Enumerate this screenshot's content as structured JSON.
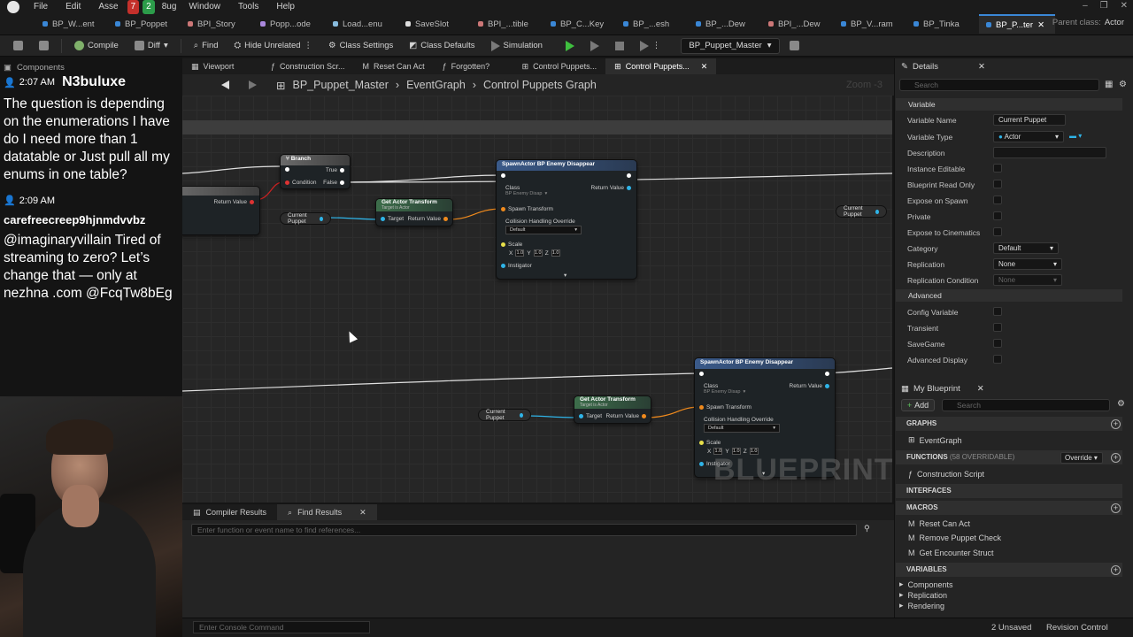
{
  "menu": [
    "File",
    "Edit",
    "Asse",
    "Window",
    "Tools",
    "Help"
  ],
  "notify": {
    "youtube": "7",
    "green": "2",
    "other": "8ug"
  },
  "doc_tabs": [
    "BP_W...ent",
    "BP_Poppet",
    "BPI_Story",
    "Popp...ode",
    "Load...enu",
    "SaveSlot",
    "BPI_...tible",
    "BP_C...Key",
    "BP_...esh",
    "BP_...Dew",
    "BPI_...Dew",
    "BP_V...ram",
    "BP_Tinka",
    "BP_P...ter"
  ],
  "parent_class": {
    "label": "Parent class:",
    "value": "Actor"
  },
  "toolbar": {
    "compile": "Compile",
    "diff": "Diff",
    "find": "Find",
    "hide_unrelated": "Hide Unrelated",
    "class_settings": "Class Settings",
    "class_defaults": "Class Defaults",
    "simulation": "Simulation",
    "debug_object": "BP_Puppet_Master"
  },
  "components_tab": "Components",
  "chat": {
    "time1": "2:07 AM",
    "user1": "N3buluxe",
    "msg1": "The question is depending on the enumerations I have do I need more than 1 datatable or Just pull all my enums in one table?",
    "time2": "2:09 AM",
    "user2": "carefreecreep9hjnmdvvbz",
    "msg2": "@imaginaryvillain Tired of streaming to zero? Let’s change that — only at nezhna .com @FcqTw8bEg"
  },
  "graph_tabs": [
    "Viewport",
    "Construction Scr...",
    "Reset Can Act",
    "Forgotten?",
    "Control Puppets...",
    "Control Puppets..."
  ],
  "breadcrumb": {
    "root": "BP_Puppet_Master",
    "sep": "›",
    "event": "EventGraph",
    "graph": "Control Puppets Graph"
  },
  "zoom": "Zoom -3",
  "watermark": "BLUEPRINT",
  "nodes": {
    "branch": {
      "title": "Branch",
      "true": "True",
      "false": "False",
      "condition": "Condition"
    },
    "left_node": {
      "return": "Return Value"
    },
    "current_puppet": "Current Puppet",
    "get_actor_transform": {
      "title": "Get Actor Transform",
      "sub": "Target is Actor",
      "target": "Target",
      "return": "Return Value"
    },
    "spawn": {
      "title": "SpawnActor BP Enemy Disappear",
      "class": "Class",
      "class_val": "BP Enemy Disap",
      "return": "Return Value",
      "spawn_transform": "Spawn Transform",
      "collision": "Collision Handling Override",
      "collision_val": "Default",
      "scale": "Scale",
      "sx": "1.0",
      "sy": "1.0",
      "sz": "1.0",
      "instigator": "Instigator"
    }
  },
  "bottom_tabs": {
    "compiler": "Compiler Results",
    "find": "Find Results"
  },
  "find_placeholder": "Enter function or event name to find references...",
  "console_placeholder": "Enter Console Command",
  "status": {
    "unsaved": "2 Unsaved",
    "revision": "Revision Control"
  },
  "details": {
    "tab": "Details",
    "search_placeholder": "Search",
    "section_variable": "Variable",
    "props": {
      "name_label": "Variable Name",
      "name_val": "Current Puppet",
      "type_label": "Variable Type",
      "type_val": "Actor",
      "description": "Description",
      "instance_editable": "Instance Editable",
      "bp_readonly": "Blueprint Read Only",
      "expose_spawn": "Expose on Spawn",
      "private": "Private",
      "expose_cine": "Expose to Cinematics",
      "category": "Category",
      "category_val": "Default",
      "replication": "Replication",
      "replication_val": "None",
      "rep_condition": "Replication Condition",
      "rep_condition_val": "None"
    },
    "section_advanced": "Advanced",
    "adv": {
      "config": "Config Variable",
      "transient": "Transient",
      "savegame": "SaveGame",
      "adv_display": "Advanced Display"
    }
  },
  "myblueprint": {
    "tab": "My Blueprint",
    "add": "Add",
    "search_placeholder": "Search",
    "graphs": "GRAPHS",
    "event_graph": "EventGraph",
    "functions": "FUNCTIONS",
    "functions_count": "(58 OVERRIDABLE)",
    "override": "Override",
    "construction": "Construction Script",
    "interfaces": "INTERFACES",
    "macros": "MACROS",
    "macro_items": [
      "Reset Can Act",
      "Remove Puppet Check",
      "Get Encounter Struct"
    ],
    "variables": "VARIABLES",
    "var_items": [
      "Components",
      "Replication",
      "Rendering"
    ]
  }
}
